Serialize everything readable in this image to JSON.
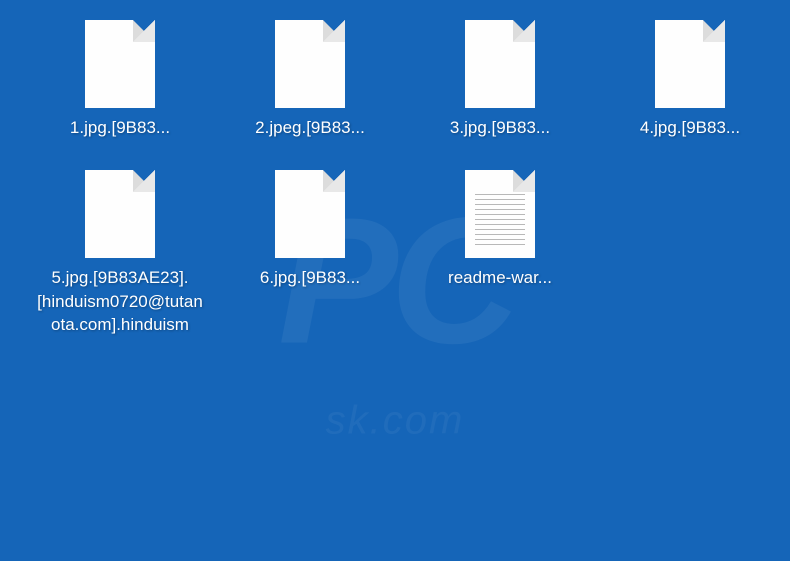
{
  "watermark": {
    "main": "PC",
    "sub": "sk.com"
  },
  "files": [
    {
      "label": "1.jpg.[9B83...",
      "type": "blank"
    },
    {
      "label": "2.jpeg.[9B83...",
      "type": "blank"
    },
    {
      "label": "3.jpg.[9B83...",
      "type": "blank"
    },
    {
      "label": "4.jpg.[9B83...",
      "type": "blank"
    },
    {
      "label": "5.jpg.[9B83AE23].[hinduism0720@tutanota.com].hinduism",
      "type": "blank"
    },
    {
      "label": "6.jpg.[9B83...",
      "type": "blank"
    },
    {
      "label": "readme-war...",
      "type": "text"
    }
  ]
}
